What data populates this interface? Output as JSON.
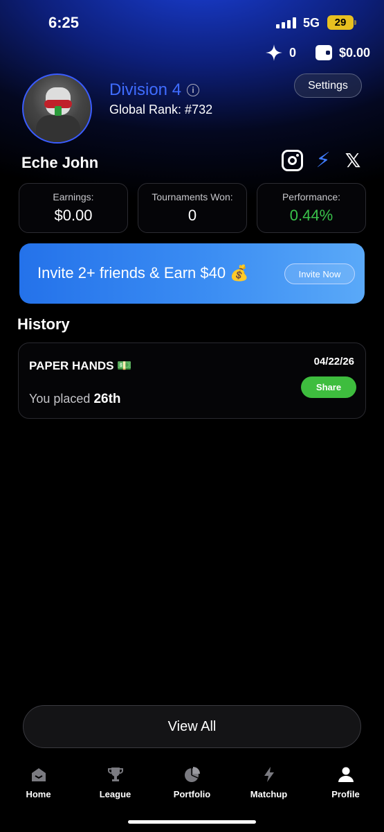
{
  "status_bar": {
    "time": "6:25",
    "network": "5G",
    "battery": "29"
  },
  "balances": {
    "stars": "0",
    "wallet": "$0.00"
  },
  "profile": {
    "division": "Division 4",
    "global_rank": "Global Rank: #732",
    "name": "Eche John",
    "settings_label": "Settings"
  },
  "stats": [
    {
      "label": "Earnings:",
      "value": "$0.00"
    },
    {
      "label": "Tournaments Won:",
      "value": "0"
    },
    {
      "label": "Performance:",
      "value": "0.44%"
    }
  ],
  "invite": {
    "text": "Invite 2+ friends & Earn $40 💰",
    "button": "Invite Now"
  },
  "history": {
    "title": "History",
    "items": [
      {
        "name": "PAPER HANDS 💵",
        "date": "04/22/26",
        "share_label": "Share",
        "placed_prefix": "You placed",
        "placed_rank": "26th"
      }
    ],
    "view_all": "View All"
  },
  "tabs": [
    {
      "label": "Home",
      "icon": "home-icon"
    },
    {
      "label": "League",
      "icon": "trophy-icon"
    },
    {
      "label": "Portfolio",
      "icon": "pie-chart-icon"
    },
    {
      "label": "Matchup",
      "icon": "lightning-icon"
    },
    {
      "label": "Profile",
      "icon": "user-icon"
    }
  ],
  "colors": {
    "accent_blue": "#3f6cff",
    "positive_green": "#39c24a",
    "share_green": "#3ebd3e"
  }
}
